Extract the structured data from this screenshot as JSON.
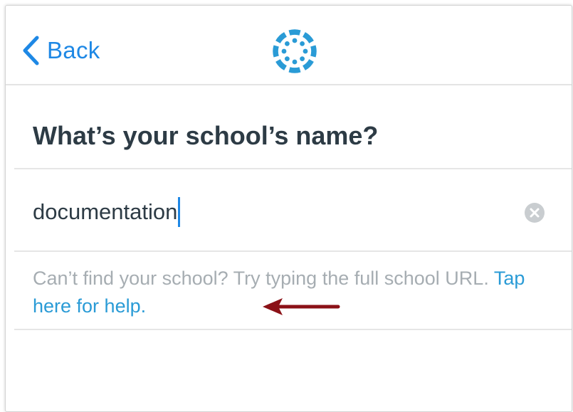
{
  "nav": {
    "back_label": "Back",
    "logo_icon": "canvas-logo-icon"
  },
  "form": {
    "title": "What’s your school’s name?",
    "input_value": "documentation",
    "clear_icon": "clear-circle-icon"
  },
  "help": {
    "text": "Can’t find your school? Try typing the full school URL.",
    "link_label": "Tap here for help."
  },
  "annotation": {
    "arrow_icon": "left-arrow-icon",
    "arrow_color": "#8b1117"
  },
  "colors": {
    "accent": "#1e88e5",
    "title": "#2d3b45",
    "muted": "#a6adb2",
    "link": "#2a9bd6",
    "logo": "#2a9bd6"
  }
}
